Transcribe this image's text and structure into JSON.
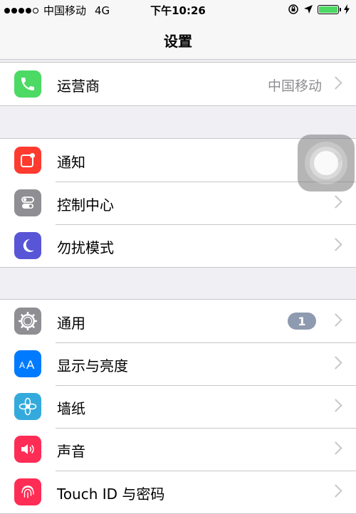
{
  "status_bar": {
    "carrier": "中国移动",
    "network": "4G",
    "time": "下午10:26",
    "signal_bars": 5,
    "signal_filled": 4,
    "battery_color": "#4cd964"
  },
  "nav": {
    "title": "设置"
  },
  "group1": [
    {
      "label": "运营商",
      "value": "中国移动",
      "icon": "phone-icon",
      "color": "#4cd964"
    }
  ],
  "group2": [
    {
      "label": "通知",
      "icon": "notifications-icon",
      "color": "#ff3b30"
    },
    {
      "label": "控制中心",
      "icon": "control-center-icon",
      "color": "#8e8e93"
    },
    {
      "label": "勿扰模式",
      "icon": "moon-icon",
      "color": "#5856d6"
    }
  ],
  "group3": [
    {
      "label": "通用",
      "badge": "1",
      "icon": "gear-icon",
      "color": "#8e8e93"
    },
    {
      "label": "显示与亮度",
      "icon": "display-aa-icon",
      "color": "#007aff"
    },
    {
      "label": "墙纸",
      "icon": "wallpaper-flower-icon",
      "color": "#34aadc"
    },
    {
      "label": "声音",
      "icon": "speaker-icon",
      "color": "#ff2d55"
    },
    {
      "label": "Touch ID 与密码",
      "icon": "fingerprint-icon",
      "color": "#ff2d55"
    }
  ]
}
